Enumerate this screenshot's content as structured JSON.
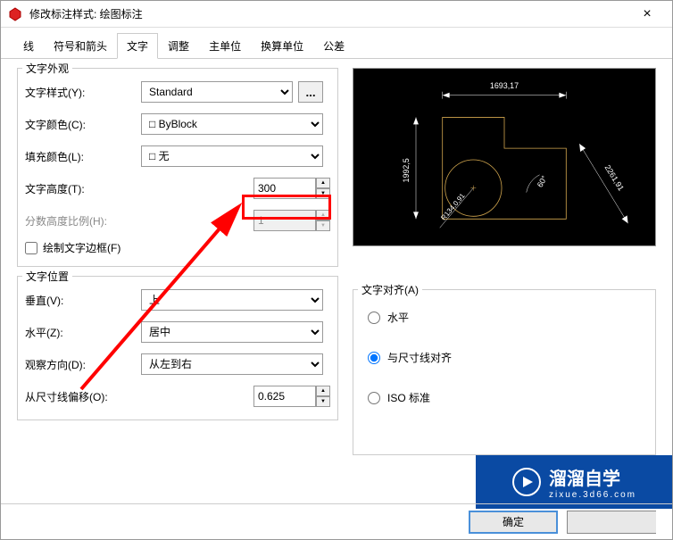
{
  "window": {
    "title": "修改标注样式: 绘图标注"
  },
  "tabs": [
    {
      "label": "线"
    },
    {
      "label": "符号和箭头"
    },
    {
      "label": "文字"
    },
    {
      "label": "调整"
    },
    {
      "label": "主单位"
    },
    {
      "label": "换算单位"
    },
    {
      "label": "公差"
    }
  ],
  "appearance": {
    "title": "文字外观",
    "styleLabel": "文字样式(Y):",
    "styleValue": "Standard",
    "dotsLabel": "...",
    "colorLabel": "文字颜色(C):",
    "colorValue": "ByBlock",
    "fillLabel": "填充颜色(L):",
    "fillValue": "无",
    "heightLabel": "文字高度(T):",
    "heightValue": "300",
    "fracLabel": "分数高度比例(H):",
    "fracValue": "1",
    "borderLabel": "绘制文字边框(F)"
  },
  "position": {
    "title": "文字位置",
    "vertLabel": "垂直(V):",
    "vertValue": "上",
    "horzLabel": "水平(Z):",
    "horzValue": "居中",
    "dirLabel": "观察方向(D):",
    "dirValue": "从左到右",
    "offsetLabel": "从尺寸线偏移(O):",
    "offsetValue": "0.625"
  },
  "align": {
    "title": "文字对齐(A)",
    "opt1": "水平",
    "opt2": "与尺寸线对齐",
    "opt3": "ISO 标准"
  },
  "footer": {
    "ok": "确定"
  },
  "watermark": {
    "brand": "溜溜自学",
    "url": "zixue.3d66.com"
  },
  "preview": {
    "dimTop": "1693,17",
    "dimLeft": "1992,5",
    "dimRight": "2261,91",
    "dimArc": "R134,0,91",
    "dimAngle": "60°"
  }
}
